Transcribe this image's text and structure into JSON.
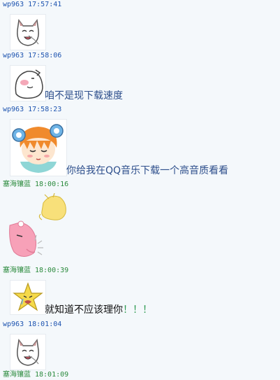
{
  "messages": [
    {
      "sender": "wp963",
      "time": "17:57:41",
      "text": "",
      "emote": "cat-face-emoticon"
    },
    {
      "sender": "wp963",
      "time": "17:58:06",
      "text": "咱不是现下载速度",
      "emote": "blushing-face-emoticon"
    },
    {
      "sender": "wp963",
      "time": "17:58:23",
      "text": "你给我在QQ音乐下载一个高音质看看",
      "emote": "orange-hair-girl-emoticon"
    },
    {
      "sender": "塞海镶蓝",
      "time": "18:00:16",
      "text": "",
      "emote": "pink-duck-slap-emoticon"
    },
    {
      "sender": "塞海镶蓝",
      "time": "18:00:39",
      "text": "就知道不应该理你",
      "text_suffix": "！！！",
      "emote": "crying-star-emoticon"
    },
    {
      "sender": "wp963",
      "time": "18:01:04",
      "text": "",
      "emote": "cat-face-emoticon"
    },
    {
      "sender": "塞海镶蓝",
      "time": "18:01:09",
      "text": "",
      "emote": ""
    }
  ],
  "colors": {
    "background": "#f4f8fb",
    "sender_wp963": "#1e54b0",
    "sender_other": "#2a8a3c",
    "message_text": "#2e4f8c"
  }
}
